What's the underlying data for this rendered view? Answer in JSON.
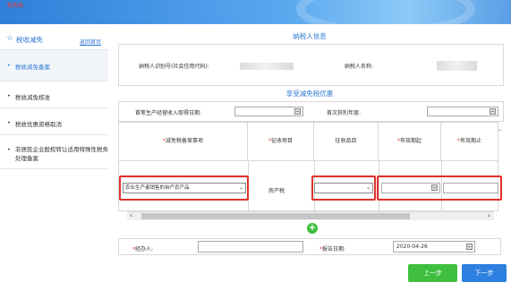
{
  "header": {
    "logo_text": "税务局"
  },
  "sidebar": {
    "title": "税收减免",
    "back_link": "返回首页",
    "items": [
      {
        "label": "税收减免备案"
      },
      {
        "label": "税收减免核准"
      },
      {
        "label": "税收优惠资格取消"
      },
      {
        "label": "非居民企业股权转让适用特殊性税务处理备案"
      }
    ]
  },
  "taxpayer": {
    "section_title": "纳税人信息",
    "id_label": "纳税人识别号(社会信用代码):",
    "name_label": "纳税人名称:"
  },
  "relief": {
    "section_title": "享受减免税优惠",
    "first_income_label": "首笔生产经营收入取得日期:",
    "first_profit_label": "首次获利年度:",
    "columns": [
      {
        "label": "减免税备案事项",
        "required": "*"
      },
      {
        "label": "征收项目",
        "required": "*"
      },
      {
        "label": "征收品目",
        "required": ""
      },
      {
        "label": "有效期起",
        "required": "*"
      },
      {
        "label": "有效期止",
        "required": "*"
      }
    ],
    "row": {
      "item_value": "农业生产者销售的自产农产品",
      "project_value": "房产税",
      "category_value": "",
      "start_value": "",
      "end_value": ""
    }
  },
  "footer": {
    "handler_label": "经办人:",
    "handler_required": "*",
    "report_date_label": "报告日期:",
    "report_date_required": "*",
    "report_date_value": "2020-04-26",
    "prev_button": "上一步",
    "next_button": "下一步"
  }
}
